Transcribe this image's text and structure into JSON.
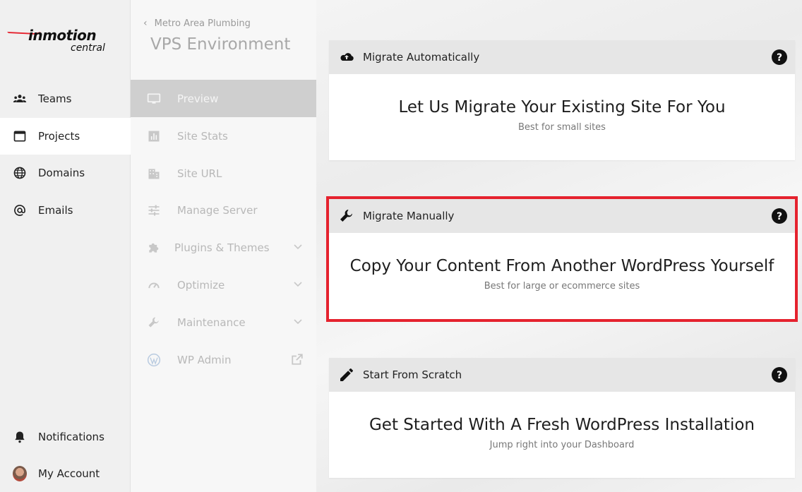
{
  "brand": {
    "name": "inmotion",
    "sub": "central",
    "accent": "#e5222e"
  },
  "leftnav": {
    "items": [
      {
        "label": "Teams",
        "icon": "teams-icon"
      },
      {
        "label": "Projects",
        "icon": "projects-icon"
      },
      {
        "label": "Domains",
        "icon": "globe-icon"
      },
      {
        "label": "Emails",
        "icon": "at-icon"
      }
    ],
    "bottom": [
      {
        "label": "Notifications",
        "icon": "bell-icon"
      },
      {
        "label": "My Account",
        "icon": "avatar"
      }
    ]
  },
  "subnav": {
    "breadcrumb": "Metro Area Plumbing",
    "title": "VPS Environment",
    "items": [
      {
        "label": "Preview",
        "icon": "monitor-icon"
      },
      {
        "label": "Site Stats",
        "icon": "bar-chart-icon"
      },
      {
        "label": "Site URL",
        "icon": "building-icon"
      },
      {
        "label": "Manage Server",
        "icon": "sliders-icon"
      },
      {
        "label": "Plugins & Themes",
        "icon": "puzzle-icon"
      },
      {
        "label": "Optimize",
        "icon": "speedometer-icon"
      },
      {
        "label": "Maintenance",
        "icon": "wrench-icon"
      },
      {
        "label": "WP Admin",
        "icon": "wordpress-icon"
      }
    ]
  },
  "cards": [
    {
      "header": "Migrate Automatically",
      "title": "Let Us Migrate Your Existing Site For You",
      "subtitle": "Best for small sites"
    },
    {
      "header": "Migrate Manually",
      "title": "Copy Your Content From Another WordPress Yourself",
      "subtitle": "Best for large or ecommerce sites"
    },
    {
      "header": "Start From Scratch",
      "title": "Get Started With A Fresh WordPress Installation",
      "subtitle": "Jump right into your Dashboard"
    }
  ]
}
